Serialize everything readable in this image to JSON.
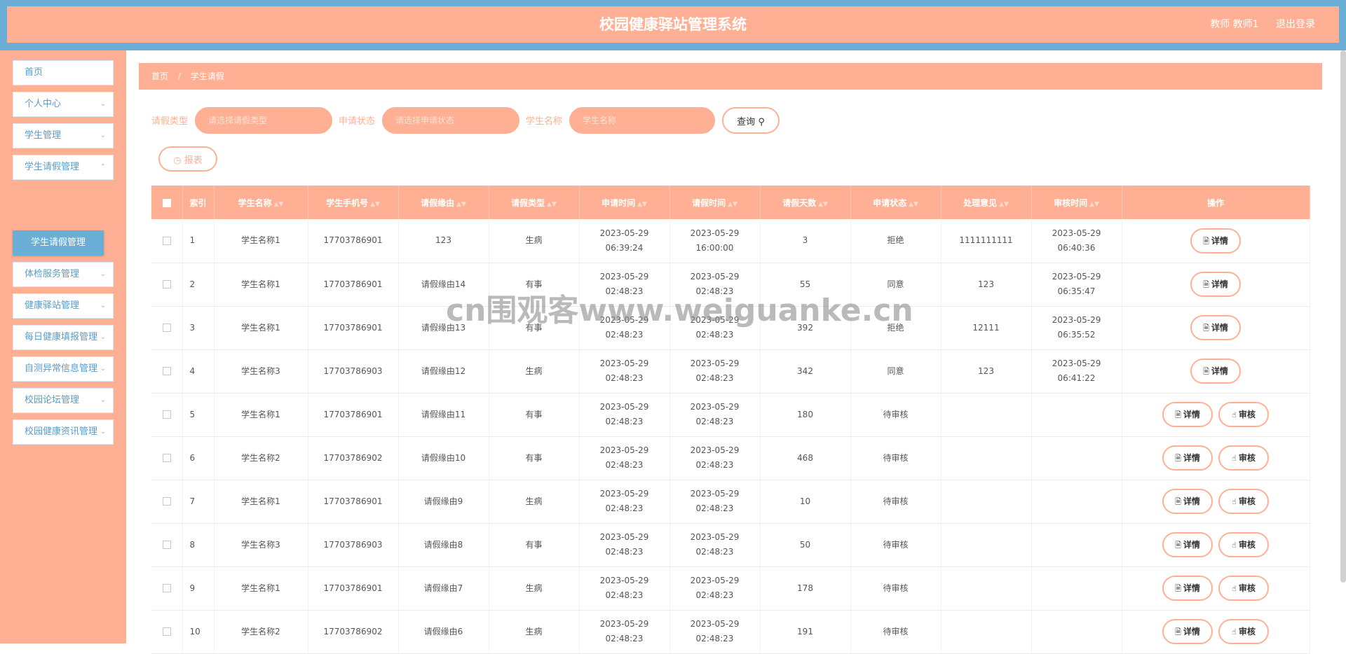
{
  "header": {
    "title": "校园健康驿站管理系统",
    "user": "教师 教师1",
    "logout": "退出登录"
  },
  "sidebar": {
    "items": [
      {
        "label": "首页",
        "has_arrow": false
      },
      {
        "label": "个人中心",
        "has_arrow": true
      },
      {
        "label": "学生管理",
        "has_arrow": true
      },
      {
        "label": "学生请假管理",
        "has_arrow": true
      },
      {
        "label": "体检服务管理",
        "has_arrow": true
      },
      {
        "label": "健康驿站管理",
        "has_arrow": true
      },
      {
        "label": "每日健康填报管理",
        "has_arrow": true
      },
      {
        "label": "自测异常信息管理",
        "has_arrow": true
      },
      {
        "label": "校园论坛管理",
        "has_arrow": true
      },
      {
        "label": "校园健康资讯管理",
        "has_arrow": true
      }
    ],
    "active_sub": "学生请假管理"
  },
  "breadcrumb": {
    "home": "首页",
    "current": "学生请假"
  },
  "filters": {
    "leave_type_label": "请假类型",
    "leave_type_placeholder": "请选择请假类型",
    "status_label": "申请状态",
    "status_placeholder": "请选择申请状态",
    "name_label": "学生名称",
    "name_placeholder": "学生名称",
    "query_button": "查询",
    "report_button": "报表"
  },
  "table": {
    "columns": [
      "",
      "索引",
      "学生名称",
      "学生手机号",
      "请假缘由",
      "请假类型",
      "申请时间",
      "请假时间",
      "请假天数",
      "申请状态",
      "处理意见",
      "审核时间",
      "操作"
    ],
    "detail_label": "详情",
    "review_label": "审核",
    "rows": [
      {
        "index": "1",
        "name": "学生名称1",
        "phone": "17703786901",
        "reason": "123",
        "type": "生病",
        "apply_time": "2023-05-29 06:39:24",
        "leave_time": "2023-05-29 16:00:00",
        "days": "3",
        "status": "拒绝",
        "opinion": "1111111111",
        "review_time": "2023-05-29 06:40:36",
        "can_review": false
      },
      {
        "index": "2",
        "name": "学生名称1",
        "phone": "17703786901",
        "reason": "请假缘由14",
        "type": "有事",
        "apply_time": "2023-05-29 02:48:23",
        "leave_time": "2023-05-29 02:48:23",
        "days": "55",
        "status": "同意",
        "opinion": "123",
        "review_time": "2023-05-29 06:35:47",
        "can_review": false
      },
      {
        "index": "3",
        "name": "学生名称1",
        "phone": "17703786901",
        "reason": "请假缘由13",
        "type": "有事",
        "apply_time": "2023-05-29 02:48:23",
        "leave_time": "2023-05-29 02:48:23",
        "days": "392",
        "status": "拒绝",
        "opinion": "12111",
        "review_time": "2023-05-29 06:35:52",
        "can_review": false
      },
      {
        "index": "4",
        "name": "学生名称3",
        "phone": "17703786903",
        "reason": "请假缘由12",
        "type": "生病",
        "apply_time": "2023-05-29 02:48:23",
        "leave_time": "2023-05-29 02:48:23",
        "days": "342",
        "status": "同意",
        "opinion": "123",
        "review_time": "2023-05-29 06:41:22",
        "can_review": false
      },
      {
        "index": "5",
        "name": "学生名称1",
        "phone": "17703786901",
        "reason": "请假缘由11",
        "type": "有事",
        "apply_time": "2023-05-29 02:48:23",
        "leave_time": "2023-05-29 02:48:23",
        "days": "180",
        "status": "待审核",
        "opinion": "",
        "review_time": "",
        "can_review": true
      },
      {
        "index": "6",
        "name": "学生名称2",
        "phone": "17703786902",
        "reason": "请假缘由10",
        "type": "有事",
        "apply_time": "2023-05-29 02:48:23",
        "leave_time": "2023-05-29 02:48:23",
        "days": "468",
        "status": "待审核",
        "opinion": "",
        "review_time": "",
        "can_review": true
      },
      {
        "index": "7",
        "name": "学生名称1",
        "phone": "17703786901",
        "reason": "请假缘由9",
        "type": "生病",
        "apply_time": "2023-05-29 02:48:23",
        "leave_time": "2023-05-29 02:48:23",
        "days": "10",
        "status": "待审核",
        "opinion": "",
        "review_time": "",
        "can_review": true
      },
      {
        "index": "8",
        "name": "学生名称3",
        "phone": "17703786903",
        "reason": "请假缘由8",
        "type": "有事",
        "apply_time": "2023-05-29 02:48:23",
        "leave_time": "2023-05-29 02:48:23",
        "days": "50",
        "status": "待审核",
        "opinion": "",
        "review_time": "",
        "can_review": true
      },
      {
        "index": "9",
        "name": "学生名称1",
        "phone": "17703786901",
        "reason": "请假缘由7",
        "type": "生病",
        "apply_time": "2023-05-29 02:48:23",
        "leave_time": "2023-05-29 02:48:23",
        "days": "178",
        "status": "待审核",
        "opinion": "",
        "review_time": "",
        "can_review": true
      },
      {
        "index": "10",
        "name": "学生名称2",
        "phone": "17703786902",
        "reason": "请假缘由6",
        "type": "生病",
        "apply_time": "2023-05-29 02:48:23",
        "leave_time": "2023-05-29 02:48:23",
        "days": "191",
        "status": "待审核",
        "opinion": "",
        "review_time": "",
        "can_review": true
      }
    ]
  },
  "watermark": "cn围观客www.weiguanke.cn",
  "colors": {
    "primary": "#ffb094",
    "accent_blue": "#6aaed6",
    "white": "#ffffff"
  }
}
